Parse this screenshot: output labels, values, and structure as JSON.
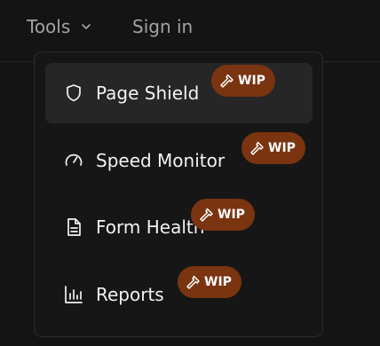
{
  "nav": {
    "tools_label": "Tools",
    "signin_label": "Sign in"
  },
  "menu": {
    "items": [
      {
        "label": "Page Shield",
        "icon": "shield-icon",
        "badge": "WIP",
        "active": true
      },
      {
        "label": "Speed Monitor",
        "icon": "gauge-icon",
        "badge": "WIP",
        "active": false
      },
      {
        "label": "Form Health",
        "icon": "document-icon",
        "badge": "WIP",
        "active": false
      },
      {
        "label": "Reports",
        "icon": "bar-chart-icon",
        "badge": "WIP",
        "active": false
      }
    ]
  },
  "colors": {
    "background": "#141414",
    "dropdown_bg": "#161616",
    "active_item_bg": "#262626",
    "badge_bg": "#7a3410",
    "nav_text": "#a3a3a3",
    "item_text": "#f2f2f2"
  }
}
